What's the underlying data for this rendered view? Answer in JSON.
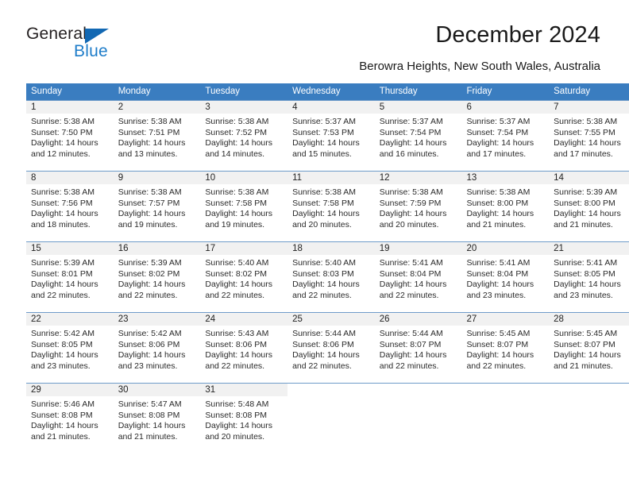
{
  "brand": {
    "name_part1": "General",
    "name_part2": "Blue",
    "accent_color": "#1d7cc9",
    "triangle_color": "#1268b3"
  },
  "header": {
    "title": "December 2024",
    "subtitle": "Berowra Heights, New South Wales, Australia"
  },
  "calendar": {
    "header_background": "#3a7dc0",
    "daynum_background": "#f1f1f1",
    "weekdays": [
      "Sunday",
      "Monday",
      "Tuesday",
      "Wednesday",
      "Thursday",
      "Friday",
      "Saturday"
    ],
    "weeks": [
      [
        {
          "day": "1",
          "sunrise": "Sunrise: 5:38 AM",
          "sunset": "Sunset: 7:50 PM",
          "daylight1": "Daylight: 14 hours",
          "daylight2": "and 12 minutes."
        },
        {
          "day": "2",
          "sunrise": "Sunrise: 5:38 AM",
          "sunset": "Sunset: 7:51 PM",
          "daylight1": "Daylight: 14 hours",
          "daylight2": "and 13 minutes."
        },
        {
          "day": "3",
          "sunrise": "Sunrise: 5:38 AM",
          "sunset": "Sunset: 7:52 PM",
          "daylight1": "Daylight: 14 hours",
          "daylight2": "and 14 minutes."
        },
        {
          "day": "4",
          "sunrise": "Sunrise: 5:37 AM",
          "sunset": "Sunset: 7:53 PM",
          "daylight1": "Daylight: 14 hours",
          "daylight2": "and 15 minutes."
        },
        {
          "day": "5",
          "sunrise": "Sunrise: 5:37 AM",
          "sunset": "Sunset: 7:54 PM",
          "daylight1": "Daylight: 14 hours",
          "daylight2": "and 16 minutes."
        },
        {
          "day": "6",
          "sunrise": "Sunrise: 5:37 AM",
          "sunset": "Sunset: 7:54 PM",
          "daylight1": "Daylight: 14 hours",
          "daylight2": "and 17 minutes."
        },
        {
          "day": "7",
          "sunrise": "Sunrise: 5:38 AM",
          "sunset": "Sunset: 7:55 PM",
          "daylight1": "Daylight: 14 hours",
          "daylight2": "and 17 minutes."
        }
      ],
      [
        {
          "day": "8",
          "sunrise": "Sunrise: 5:38 AM",
          "sunset": "Sunset: 7:56 PM",
          "daylight1": "Daylight: 14 hours",
          "daylight2": "and 18 minutes."
        },
        {
          "day": "9",
          "sunrise": "Sunrise: 5:38 AM",
          "sunset": "Sunset: 7:57 PM",
          "daylight1": "Daylight: 14 hours",
          "daylight2": "and 19 minutes."
        },
        {
          "day": "10",
          "sunrise": "Sunrise: 5:38 AM",
          "sunset": "Sunset: 7:58 PM",
          "daylight1": "Daylight: 14 hours",
          "daylight2": "and 19 minutes."
        },
        {
          "day": "11",
          "sunrise": "Sunrise: 5:38 AM",
          "sunset": "Sunset: 7:58 PM",
          "daylight1": "Daylight: 14 hours",
          "daylight2": "and 20 minutes."
        },
        {
          "day": "12",
          "sunrise": "Sunrise: 5:38 AM",
          "sunset": "Sunset: 7:59 PM",
          "daylight1": "Daylight: 14 hours",
          "daylight2": "and 20 minutes."
        },
        {
          "day": "13",
          "sunrise": "Sunrise: 5:38 AM",
          "sunset": "Sunset: 8:00 PM",
          "daylight1": "Daylight: 14 hours",
          "daylight2": "and 21 minutes."
        },
        {
          "day": "14",
          "sunrise": "Sunrise: 5:39 AM",
          "sunset": "Sunset: 8:00 PM",
          "daylight1": "Daylight: 14 hours",
          "daylight2": "and 21 minutes."
        }
      ],
      [
        {
          "day": "15",
          "sunrise": "Sunrise: 5:39 AM",
          "sunset": "Sunset: 8:01 PM",
          "daylight1": "Daylight: 14 hours",
          "daylight2": "and 22 minutes."
        },
        {
          "day": "16",
          "sunrise": "Sunrise: 5:39 AM",
          "sunset": "Sunset: 8:02 PM",
          "daylight1": "Daylight: 14 hours",
          "daylight2": "and 22 minutes."
        },
        {
          "day": "17",
          "sunrise": "Sunrise: 5:40 AM",
          "sunset": "Sunset: 8:02 PM",
          "daylight1": "Daylight: 14 hours",
          "daylight2": "and 22 minutes."
        },
        {
          "day": "18",
          "sunrise": "Sunrise: 5:40 AM",
          "sunset": "Sunset: 8:03 PM",
          "daylight1": "Daylight: 14 hours",
          "daylight2": "and 22 minutes."
        },
        {
          "day": "19",
          "sunrise": "Sunrise: 5:41 AM",
          "sunset": "Sunset: 8:04 PM",
          "daylight1": "Daylight: 14 hours",
          "daylight2": "and 22 minutes."
        },
        {
          "day": "20",
          "sunrise": "Sunrise: 5:41 AM",
          "sunset": "Sunset: 8:04 PM",
          "daylight1": "Daylight: 14 hours",
          "daylight2": "and 23 minutes."
        },
        {
          "day": "21",
          "sunrise": "Sunrise: 5:41 AM",
          "sunset": "Sunset: 8:05 PM",
          "daylight1": "Daylight: 14 hours",
          "daylight2": "and 23 minutes."
        }
      ],
      [
        {
          "day": "22",
          "sunrise": "Sunrise: 5:42 AM",
          "sunset": "Sunset: 8:05 PM",
          "daylight1": "Daylight: 14 hours",
          "daylight2": "and 23 minutes."
        },
        {
          "day": "23",
          "sunrise": "Sunrise: 5:42 AM",
          "sunset": "Sunset: 8:06 PM",
          "daylight1": "Daylight: 14 hours",
          "daylight2": "and 23 minutes."
        },
        {
          "day": "24",
          "sunrise": "Sunrise: 5:43 AM",
          "sunset": "Sunset: 8:06 PM",
          "daylight1": "Daylight: 14 hours",
          "daylight2": "and 22 minutes."
        },
        {
          "day": "25",
          "sunrise": "Sunrise: 5:44 AM",
          "sunset": "Sunset: 8:06 PM",
          "daylight1": "Daylight: 14 hours",
          "daylight2": "and 22 minutes."
        },
        {
          "day": "26",
          "sunrise": "Sunrise: 5:44 AM",
          "sunset": "Sunset: 8:07 PM",
          "daylight1": "Daylight: 14 hours",
          "daylight2": "and 22 minutes."
        },
        {
          "day": "27",
          "sunrise": "Sunrise: 5:45 AM",
          "sunset": "Sunset: 8:07 PM",
          "daylight1": "Daylight: 14 hours",
          "daylight2": "and 22 minutes."
        },
        {
          "day": "28",
          "sunrise": "Sunrise: 5:45 AM",
          "sunset": "Sunset: 8:07 PM",
          "daylight1": "Daylight: 14 hours",
          "daylight2": "and 21 minutes."
        }
      ],
      [
        {
          "day": "29",
          "sunrise": "Sunrise: 5:46 AM",
          "sunset": "Sunset: 8:08 PM",
          "daylight1": "Daylight: 14 hours",
          "daylight2": "and 21 minutes."
        },
        {
          "day": "30",
          "sunrise": "Sunrise: 5:47 AM",
          "sunset": "Sunset: 8:08 PM",
          "daylight1": "Daylight: 14 hours",
          "daylight2": "and 21 minutes."
        },
        {
          "day": "31",
          "sunrise": "Sunrise: 5:48 AM",
          "sunset": "Sunset: 8:08 PM",
          "daylight1": "Daylight: 14 hours",
          "daylight2": "and 20 minutes."
        },
        {
          "day": "",
          "sunrise": "",
          "sunset": "",
          "daylight1": "",
          "daylight2": ""
        },
        {
          "day": "",
          "sunrise": "",
          "sunset": "",
          "daylight1": "",
          "daylight2": ""
        },
        {
          "day": "",
          "sunrise": "",
          "sunset": "",
          "daylight1": "",
          "daylight2": ""
        },
        {
          "day": "",
          "sunrise": "",
          "sunset": "",
          "daylight1": "",
          "daylight2": ""
        }
      ]
    ]
  }
}
